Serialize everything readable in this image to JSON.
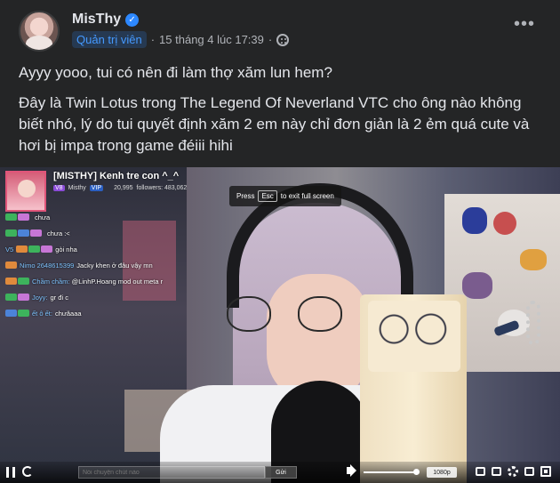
{
  "post": {
    "author": "MisThy",
    "role": "Quản trị viên",
    "timestamp": "15 tháng 4 lúc 17:39",
    "separator": "·",
    "more_label": "•••",
    "paragraphs": [
      "Ayyy yooo, tui có nên đi làm thợ xăm lun hem?",
      "Đây là Twin Lotus trong The Legend Of Neverland VTC cho ông nào không biết nhó, lý do tui quyết định xăm 2 em này chỉ đơn giản là 2 ẻm quá cute và hơi bị impa trong game đéiii hihi"
    ],
    "privacy_icon": "group-icon",
    "verified_icon": "verified-badge-icon"
  },
  "video": {
    "stream_title": "[MISTHY] Kenh tre con ^_^",
    "streamer_level": "V8",
    "streamer_name": "Misthy",
    "vip_label": "VIP",
    "viewers": "20,995",
    "followers_label": "followers: 483,062",
    "exit_hint": {
      "before": "Press",
      "key": "Esc",
      "after": "to exit full screen"
    },
    "chat": [
      {
        "user": "",
        "msg": "chưa"
      },
      {
        "user": "",
        "msg": "chưa :<"
      },
      {
        "user": "V5",
        "msg": "gòi nha"
      },
      {
        "user": "Nimo 2648615399",
        "msg": "Jacky khen ở đâu vậy mn"
      },
      {
        "user": "Chầm chầm:",
        "msg": "@LinhP.Hoang mod out meta r"
      },
      {
        "user": "Joyy:",
        "msg": "gr đi c"
      },
      {
        "user": "ết ô ết:",
        "msg": "chưăaaa"
      }
    ],
    "controls": {
      "chat_placeholder": "Nói chuyện chút nào",
      "send_label": "Gửi",
      "quality": "1080p",
      "volume": 0.9
    }
  },
  "colors": {
    "background": "#242526",
    "text": "#e4e6eb",
    "secondary": "#b0b3b8",
    "accent": "#2d88ff"
  }
}
